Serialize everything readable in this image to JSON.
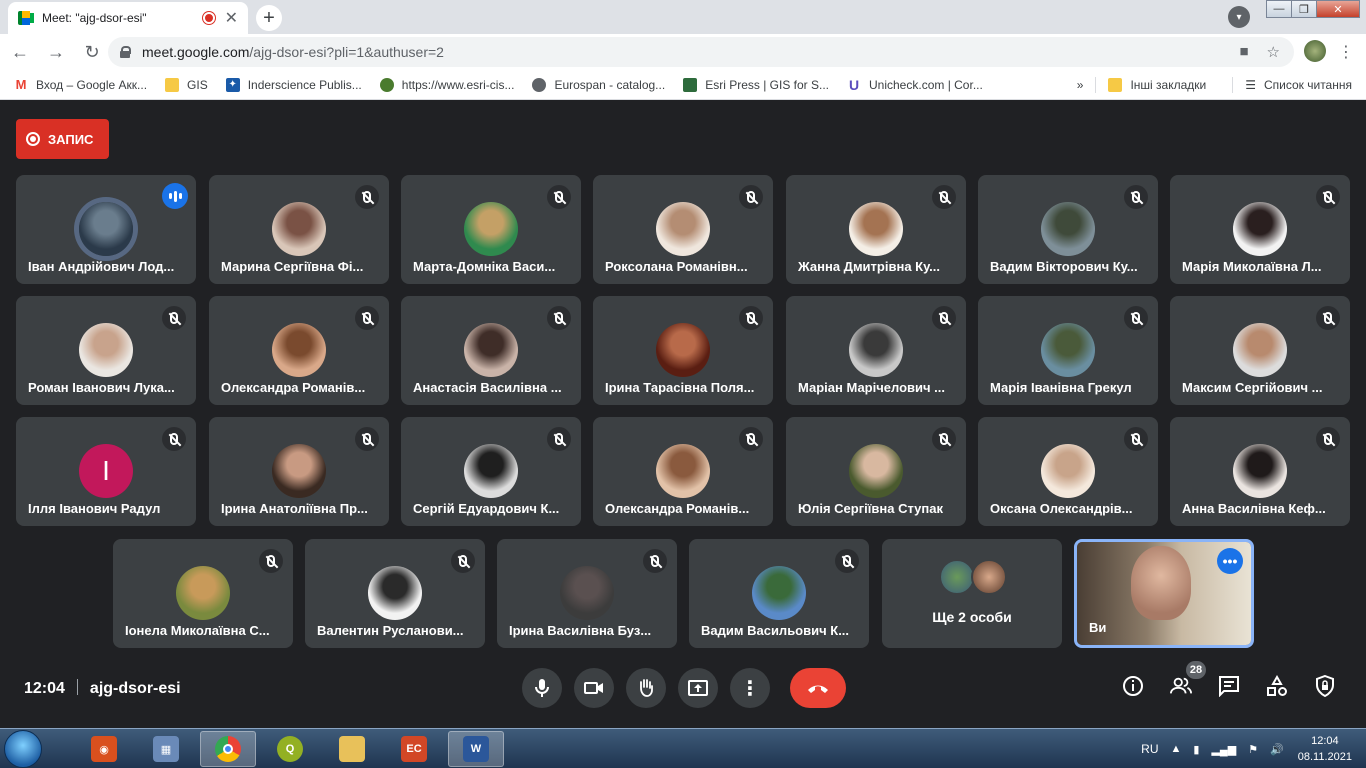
{
  "browser": {
    "tab_title": "Meet: \"ajg-dsor-esi\"",
    "url_domain": "meet.google.com",
    "url_path": "/ajg-dsor-esi?pli=1&authuser=2",
    "bookmarks": [
      {
        "label": "Вход – Google Акк...",
        "icon": "gmail-icon",
        "color": "#ea4335"
      },
      {
        "label": "GIS",
        "icon": "folder-icon",
        "color": "#f6c945"
      },
      {
        "label": "Inderscience Publis...",
        "icon": "inderscience-icon",
        "color": "#1a5aa8"
      },
      {
        "label": "https://www.esri-cis...",
        "icon": "globe-icon",
        "color": "#4a7b2e"
      },
      {
        "label": "Eurospan - catalog...",
        "icon": "globe-icon",
        "color": "#5f6368"
      },
      {
        "label": "Esri Press | GIS for S...",
        "icon": "esri-icon",
        "color": "#2e6b3c"
      },
      {
        "label": "Unicheck.com | Cor...",
        "icon": "unicheck-icon",
        "color": "#5b4dbd"
      }
    ],
    "other_bookmarks": "Інші закладки",
    "reading_list": "Список читання"
  },
  "meet": {
    "recording_label": "ЗАПИС",
    "participants": [
      {
        "name": "Іван Андрійович Лод...",
        "speaking": true,
        "c1": "#2b3a4a",
        "c2": "#6a7d8d"
      },
      {
        "name": "Марина Сергіївна Фі...",
        "c1": "#d9c6b8",
        "c2": "#7a5245"
      },
      {
        "name": "Марта-Домніка Васи...",
        "c1": "#2f8a4e",
        "c2": "#c4a066"
      },
      {
        "name": "Роксолана Романівн...",
        "c1": "#efe6dd",
        "c2": "#b48d73"
      },
      {
        "name": "Жанна Дмитрівна Ку...",
        "c1": "#f4eee6",
        "c2": "#a47352"
      },
      {
        "name": "Вадим Вікторович Ку...",
        "c1": "#7e8f98",
        "c2": "#3f4a3a"
      },
      {
        "name": "Марія Миколаївна Л...",
        "c1": "#f2f2f2",
        "c2": "#2a1f1f"
      },
      {
        "name": "Роман Іванович Лука...",
        "c1": "#eae6e1",
        "c2": "#c8a38c"
      },
      {
        "name": "Олександра Романів...",
        "c1": "#d9a889",
        "c2": "#7a4a2e"
      },
      {
        "name": "Анастасія Василівна ...",
        "c1": "#c9b3a8",
        "c2": "#3f2d28"
      },
      {
        "name": "Ірина Тарасівна Поля...",
        "c1": "#5a1e12",
        "c2": "#b86a4a"
      },
      {
        "name": "Маріан Марічелович ...",
        "c1": "#c8c8c8",
        "c2": "#3a3a3a"
      },
      {
        "name": "Марія Іванівна Грекул",
        "c1": "#6a8ea0",
        "c2": "#4a5a3a"
      },
      {
        "name": "Максим Сергійович ...",
        "c1": "#dcdcdc",
        "c2": "#b88a6e"
      },
      {
        "name": "Ілля Іванович Радул",
        "initial": "І",
        "c1": "#c2185b",
        "c2": "#c2185b"
      },
      {
        "name": "Ірина Анатоліївна Пр...",
        "c1": "#3a2a22",
        "c2": "#c89a82"
      },
      {
        "name": "Сергій Едуардович К...",
        "c1": "#dcdcdc",
        "c2": "#1f1f1f"
      },
      {
        "name": "Олександра Романів...",
        "c1": "#e2c2a8",
        "c2": "#8a5a3e"
      },
      {
        "name": "Юлія Сергіївна Ступак",
        "c1": "#4a5a2e",
        "c2": "#d8b8a0"
      },
      {
        "name": "Оксана Олександрів...",
        "c1": "#f4e8dc",
        "c2": "#c8a48a"
      },
      {
        "name": "Анна Василівна Кеф...",
        "c1": "#eae4e0",
        "c2": "#1f1a1a"
      },
      {
        "name": "Іонела Миколаївна С...",
        "c1": "#7a8a3e",
        "c2": "#c89a5a"
      },
      {
        "name": "Валентин Русланови...",
        "c1": "#f2f2f2",
        "c2": "#2a2a2a"
      },
      {
        "name": "Ірина Василівна Буз...",
        "c1": "#3c3c3c",
        "c2": "#5a5050"
      },
      {
        "name": "Вадим Васильович К...",
        "c1": "#5a8ac8",
        "c2": "#3a6a3a"
      }
    ],
    "more_label": "Ще 2 особи",
    "self_label": "Ви",
    "time": "12:04",
    "meeting_code": "ajg-dsor-esi",
    "people_count": "28"
  },
  "taskbar": {
    "lang": "RU",
    "time": "12:04",
    "date": "08.11.2021"
  }
}
